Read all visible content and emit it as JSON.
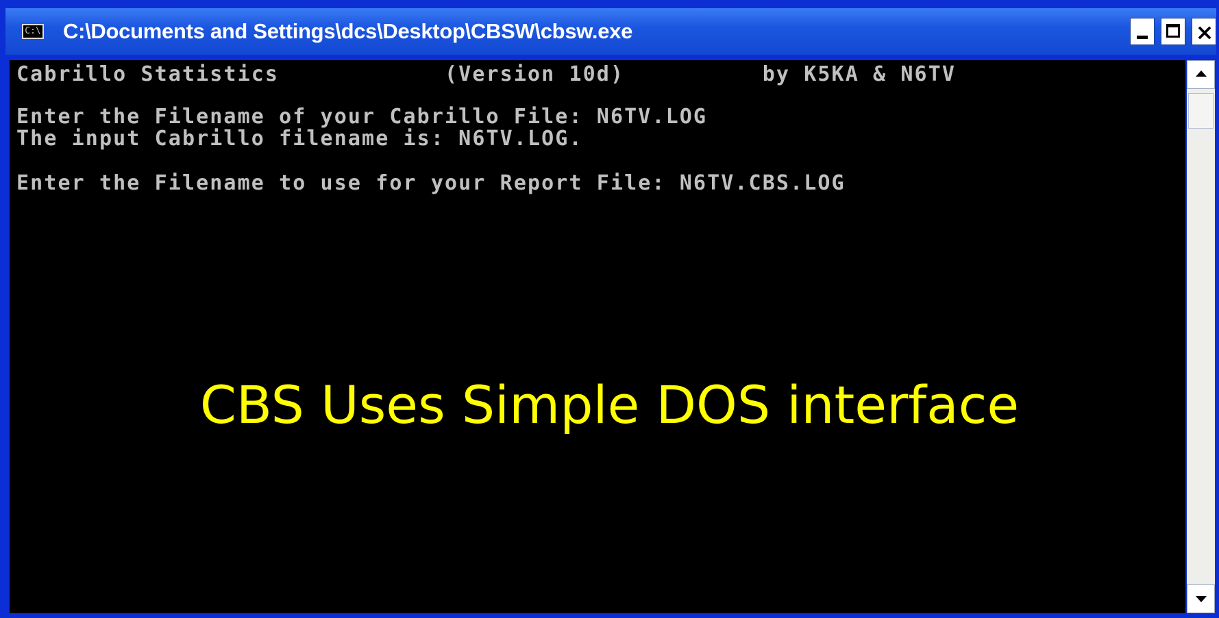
{
  "window": {
    "title": "C:\\Documents and Settings\\dcs\\Desktop\\CBSW\\cbsw.exe",
    "icon": "console-icon",
    "icon_text": "C:\\",
    "controls": {
      "minimize": "minimize-icon",
      "maximize": "maximize-icon",
      "close_label": "×"
    }
  },
  "console": {
    "lines": [
      "Cabrillo Statistics            (Version 10d)          by K5KA & N6TV",
      "Enter the Filename of your Cabrillo File: N6TV.LOG",
      "The input Cabrillo filename is: N6TV.LOG.",
      "Enter the Filename to use for your Report File: N6TV.CBS.LOG"
    ]
  },
  "caption": "CBS Uses Simple DOS interface",
  "colors": {
    "slide_background": "#000080",
    "titlebar": "#1c57e0",
    "console_text": "#c0c0c0",
    "caption_text": "#ffff00"
  }
}
